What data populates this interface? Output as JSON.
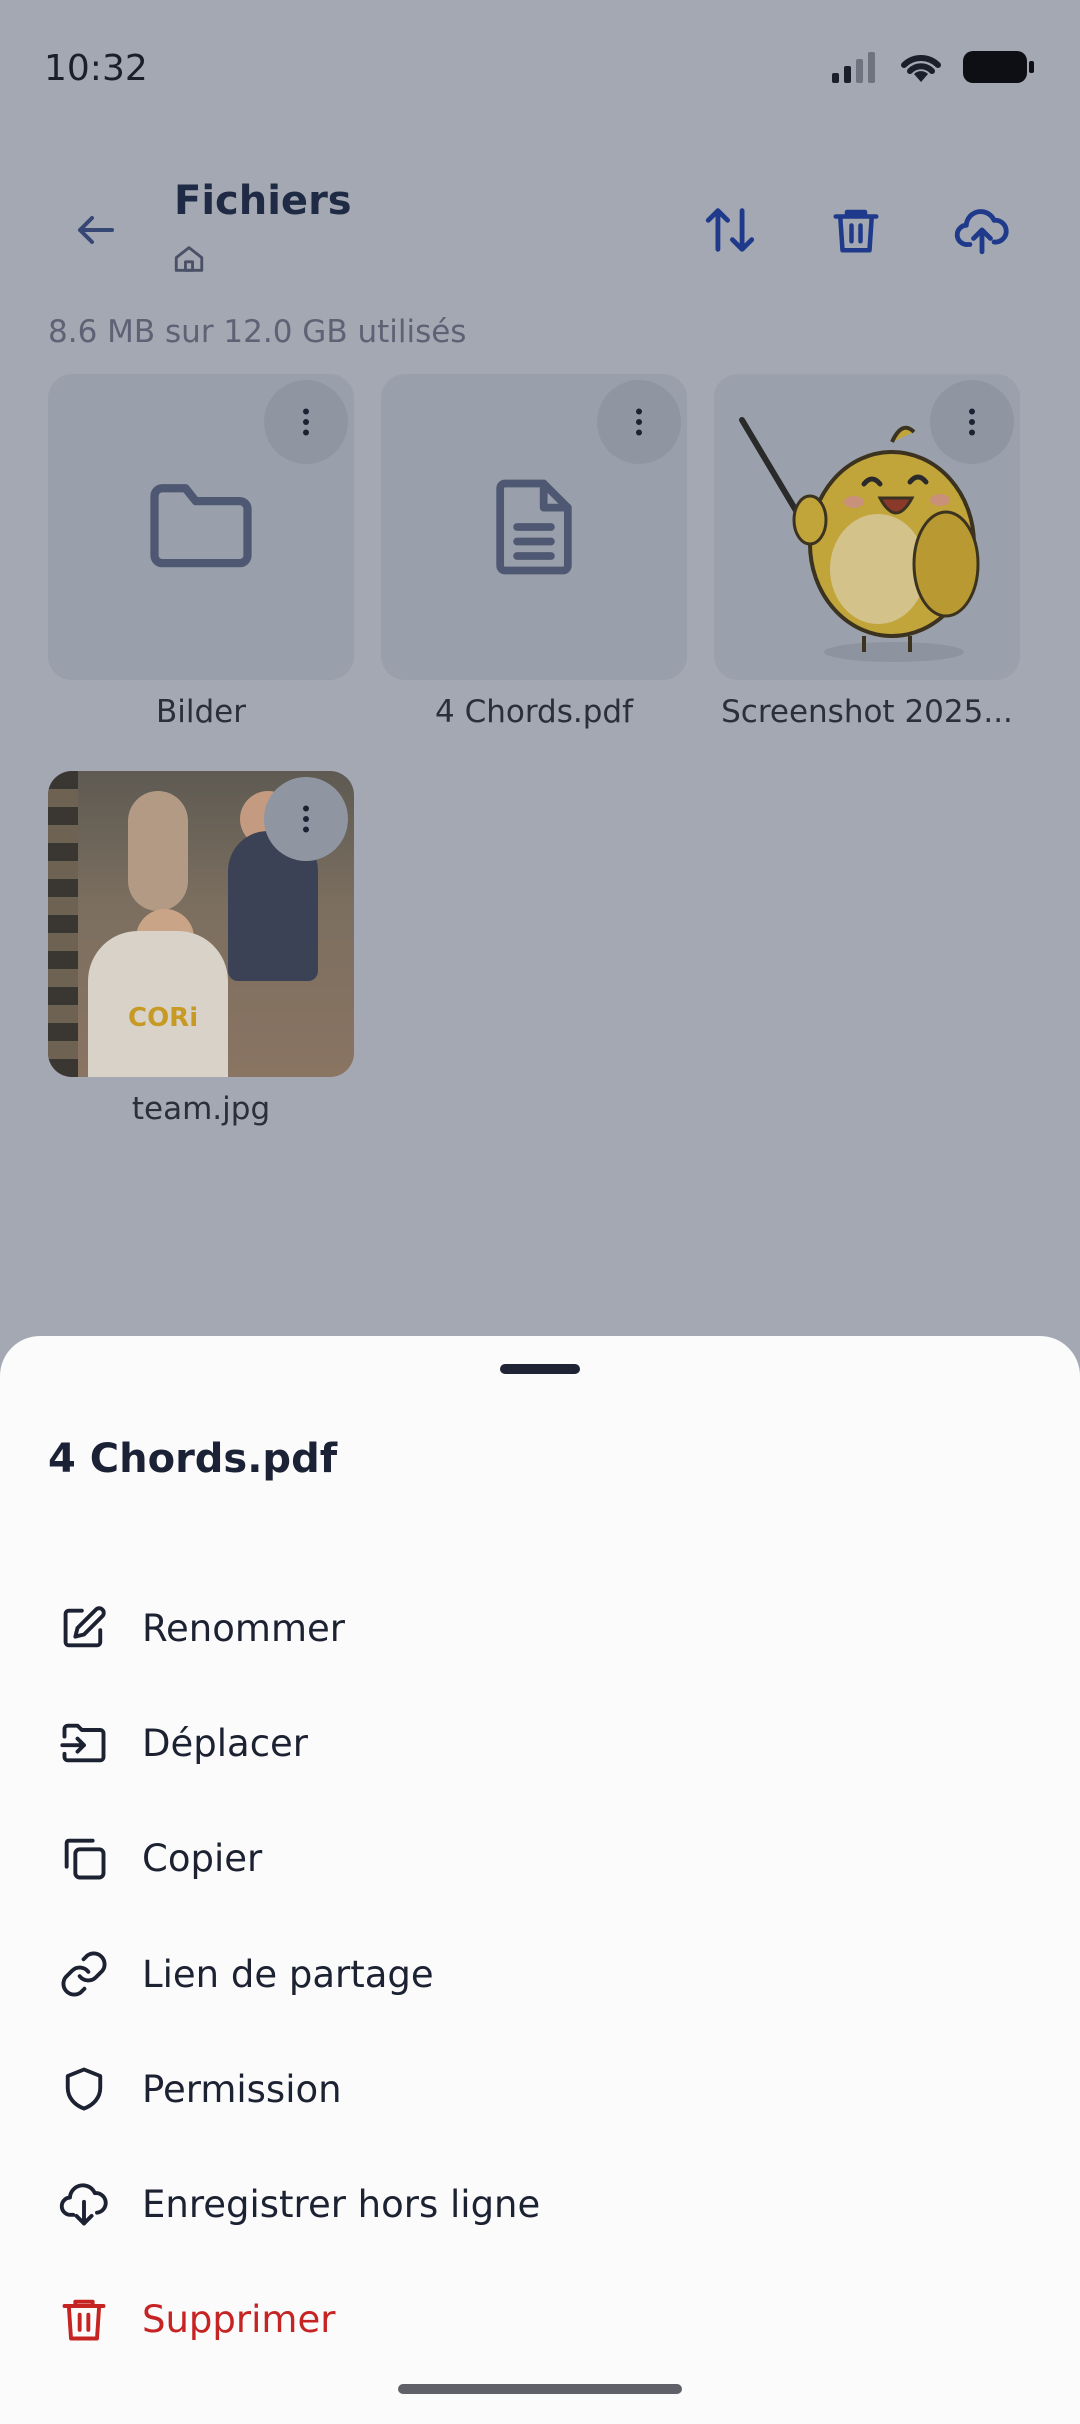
{
  "status_bar": {
    "time": "10:32"
  },
  "header": {
    "title": "Fichiers"
  },
  "storage_text": "8.6 MB sur 12.0 GB utilisés",
  "files": [
    {
      "name": "Bilder",
      "kind": "folder"
    },
    {
      "name": "4 Chords.pdf",
      "kind": "document"
    },
    {
      "name": "Screenshot 2025...",
      "kind": "image"
    },
    {
      "name": "team.jpg",
      "kind": "image"
    }
  ],
  "team_shirt_text": "CORi",
  "sheet": {
    "title": "4 Chords.pdf",
    "items": [
      {
        "label": "Renommer",
        "icon": "edit-icon"
      },
      {
        "label": "Déplacer",
        "icon": "move-icon"
      },
      {
        "label": "Copier",
        "icon": "copy-icon"
      },
      {
        "label": "Lien de partage",
        "icon": "link-icon"
      },
      {
        "label": "Permission",
        "icon": "shield-icon"
      },
      {
        "label": "Enregistrer hors ligne",
        "icon": "cloud-download-icon"
      },
      {
        "label": "Supprimer",
        "icon": "trash-icon"
      }
    ]
  },
  "colors": {
    "accent": "#1f3a8a",
    "danger": "#c62323",
    "scrim": "#a3a8b3"
  }
}
